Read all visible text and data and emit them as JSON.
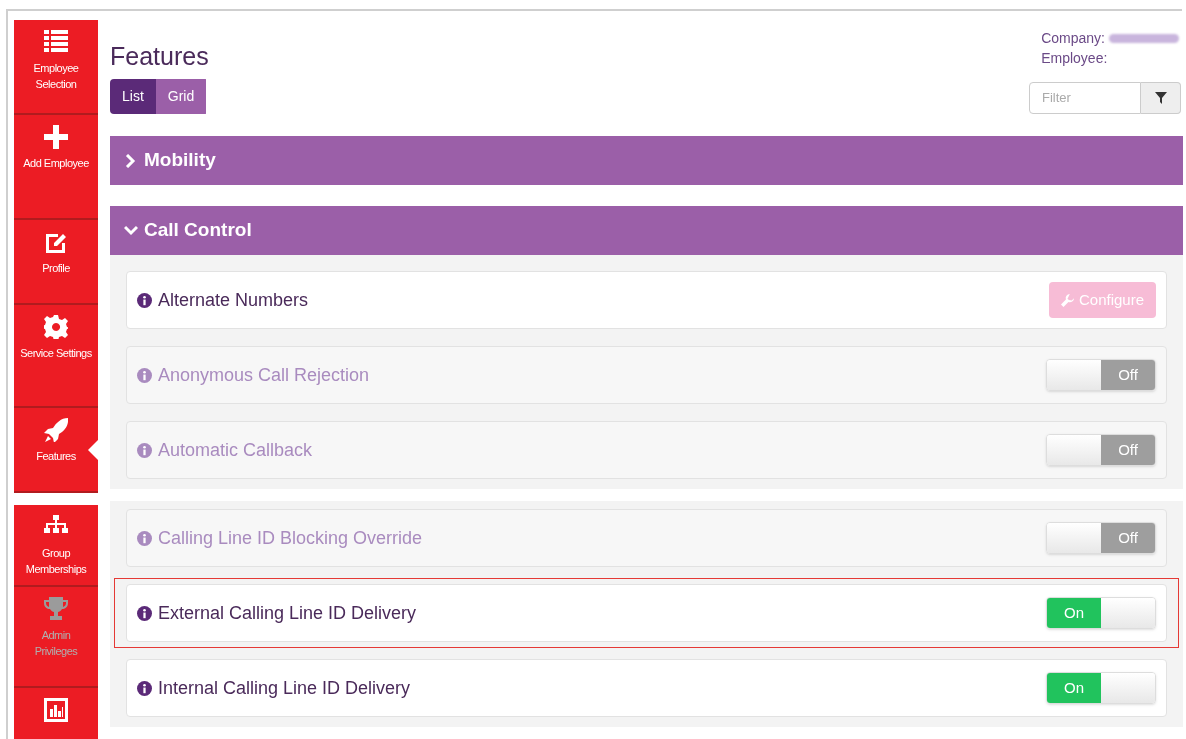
{
  "sidebar": {
    "groups": [
      [
        {
          "label": "Employee Selection",
          "selected": false,
          "disabled": false
        },
        {
          "label": "Add Employee",
          "selected": false,
          "disabled": false
        },
        {
          "label": "Profile",
          "selected": false,
          "disabled": false
        },
        {
          "label": "Service Settings",
          "selected": false,
          "disabled": false
        },
        {
          "label": "Features",
          "selected": true,
          "disabled": false
        }
      ],
      [
        {
          "label": "Group Memberships",
          "selected": false,
          "disabled": false
        },
        {
          "label": "Admin Privileges",
          "selected": false,
          "disabled": true
        },
        {
          "selected": false,
          "disabled": false
        }
      ]
    ]
  },
  "header": {
    "title": "Features",
    "views": [
      {
        "label": "List",
        "selected": true
      },
      {
        "label": "Grid",
        "selected": false
      }
    ],
    "company_label": "Company:",
    "employee_label": "Employee:",
    "filter": {
      "placeholder": "Filter"
    }
  },
  "sections": [
    {
      "title": "Mobility",
      "expanded": false
    },
    {
      "title": "Call Control",
      "expanded": true
    }
  ],
  "feature_groups": [
    [
      {
        "label": "Alternate Numbers",
        "disabled": false,
        "highlighted": false,
        "control": {
          "kind": "button",
          "label": "Configure"
        }
      },
      {
        "label": "Anonymous Call Rejection",
        "disabled": true,
        "highlighted": false,
        "control": {
          "kind": "toggle",
          "on": false,
          "label": "Off"
        }
      },
      {
        "label": "Automatic Callback",
        "disabled": true,
        "highlighted": false,
        "control": {
          "kind": "toggle",
          "on": false,
          "label": "Off"
        }
      }
    ],
    [
      {
        "label": "Calling Line ID Blocking Override",
        "disabled": true,
        "highlighted": false,
        "control": {
          "kind": "toggle",
          "on": false,
          "label": "Off"
        }
      },
      {
        "label": "External Calling Line ID Delivery",
        "disabled": false,
        "highlighted": true,
        "control": {
          "kind": "toggle",
          "on": true,
          "label": "On"
        }
      },
      {
        "label": "Internal Calling Line ID Delivery",
        "disabled": false,
        "highlighted": false,
        "control": {
          "kind": "toggle",
          "on": true,
          "label": "On"
        }
      }
    ]
  ]
}
